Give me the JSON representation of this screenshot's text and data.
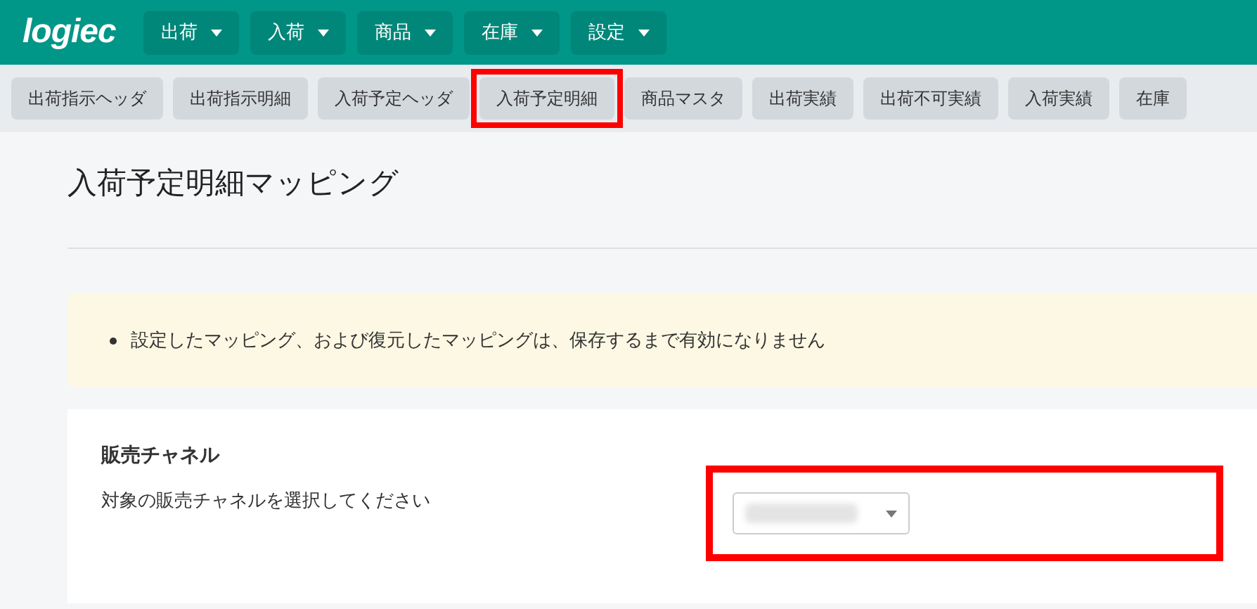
{
  "logo": "logiec",
  "menu": [
    {
      "label": "出荷"
    },
    {
      "label": "入荷"
    },
    {
      "label": "商品"
    },
    {
      "label": "在庫"
    },
    {
      "label": "設定"
    }
  ],
  "tabs": [
    {
      "label": "出荷指示ヘッダ",
      "selected": false
    },
    {
      "label": "出荷指示明細",
      "selected": false
    },
    {
      "label": "入荷予定ヘッダ",
      "selected": false
    },
    {
      "label": "入荷予定明細",
      "selected": true
    },
    {
      "label": "商品マスタ",
      "selected": false
    },
    {
      "label": "出荷実績",
      "selected": false
    },
    {
      "label": "出荷不可実績",
      "selected": false
    },
    {
      "label": "入荷実績",
      "selected": false
    },
    {
      "label": "在庫",
      "selected": false
    }
  ],
  "page_title": "入荷予定明細マッピング",
  "notice": {
    "items": [
      "設定したマッピング、および復元したマッピングは、保存するまで有効になりません"
    ]
  },
  "sales_channel": {
    "heading": "販売チャネル",
    "description": "対象の販売チャネルを選択してください",
    "select": {
      "value_blurred": true,
      "highlighted": true
    }
  }
}
